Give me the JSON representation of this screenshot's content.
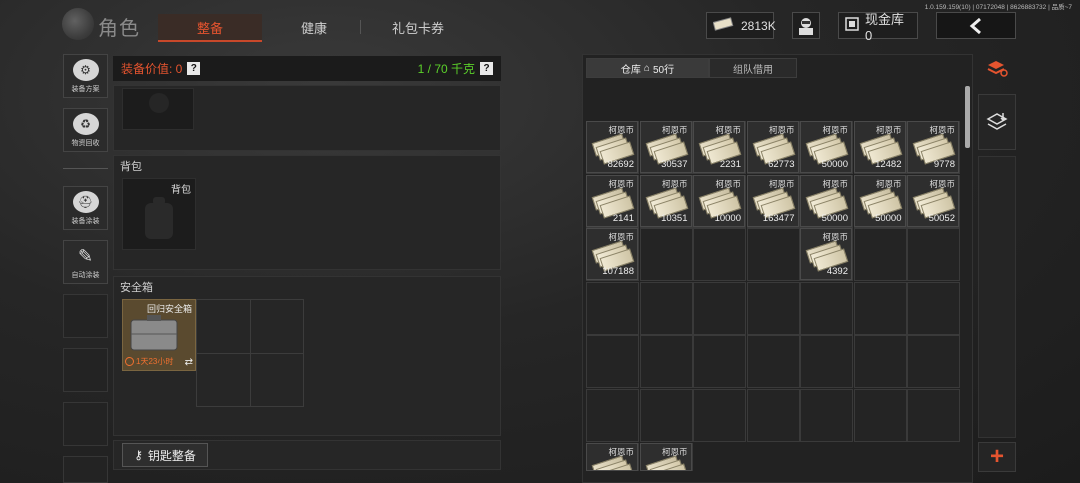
{
  "version_text": "1.0.159.159(10) | 07172048 | 8626883732 | 品质~7",
  "header": {
    "title": "角色",
    "tabs": [
      {
        "label": "整备",
        "active": true
      },
      {
        "label": "健康",
        "active": false
      },
      {
        "label": "礼包卡券",
        "active": false
      }
    ],
    "currency_value": "2813K",
    "cash_label": "现金库 0"
  },
  "left_menu": [
    {
      "label": "装备方案",
      "icon": "equipment-plan-icon"
    },
    {
      "label": "物资回收",
      "icon": "recycle-icon"
    },
    {
      "label": "装备涂装",
      "icon": "equipment-paint-icon"
    },
    {
      "label": "自动涂装",
      "icon": "auto-paint-icon"
    }
  ],
  "equipment": {
    "value_label": "装备价值: 0",
    "capacity": "1 / 70 千克",
    "backpack_section": "背包",
    "backpack_slot": "背包",
    "safebox_section": "安全箱",
    "safebox_item": "回归安全箱",
    "safebox_timer": "1天23小时",
    "key_button": "钥匙整备"
  },
  "warehouse": {
    "tab_warehouse": "仓库",
    "tab_rows": "50行",
    "tab_team": "组队借用",
    "items": [
      {
        "name": "柯恩币",
        "qty": "82692",
        "col": 0,
        "row": 0
      },
      {
        "name": "柯恩币",
        "qty": "30537",
        "col": 1,
        "row": 0
      },
      {
        "name": "柯恩币",
        "qty": "2231",
        "col": 2,
        "row": 0
      },
      {
        "name": "柯恩币",
        "qty": "62773",
        "col": 3,
        "row": 0
      },
      {
        "name": "柯恩币",
        "qty": "50000",
        "col": 4,
        "row": 0
      },
      {
        "name": "柯恩币",
        "qty": "12482",
        "col": 5,
        "row": 0
      },
      {
        "name": "柯恩币",
        "qty": "9778",
        "col": 6,
        "row": 0
      },
      {
        "name": "柯恩币",
        "qty": "2141",
        "col": 0,
        "row": 1
      },
      {
        "name": "柯恩币",
        "qty": "10351",
        "col": 1,
        "row": 1
      },
      {
        "name": "柯恩币",
        "qty": "10000",
        "col": 2,
        "row": 1
      },
      {
        "name": "柯恩币",
        "qty": "163477",
        "col": 3,
        "row": 1
      },
      {
        "name": "柯恩币",
        "qty": "50000",
        "col": 4,
        "row": 1
      },
      {
        "name": "柯恩币",
        "qty": "50000",
        "col": 5,
        "row": 1
      },
      {
        "name": "柯恩币",
        "qty": "50052",
        "col": 6,
        "row": 1
      },
      {
        "name": "柯恩币",
        "qty": "107188",
        "col": 0,
        "row": 2
      },
      {
        "name": "柯恩币",
        "qty": "4392",
        "col": 4,
        "row": 2
      },
      {
        "name": "柯恩币",
        "qty": "",
        "col": 0,
        "row": 6
      },
      {
        "name": "柯恩币",
        "qty": "",
        "col": 1,
        "row": 6
      }
    ]
  },
  "colors": {
    "accent": "#e5542f",
    "capacity_green": "#5bd02a"
  }
}
